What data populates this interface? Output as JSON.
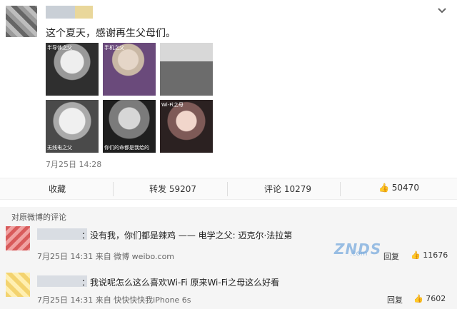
{
  "post": {
    "text": "这个夏天，感谢再生父母们。",
    "timestamp": "7月25日 14:28",
    "photos": [
      {
        "caption": "半导体之父",
        "bottom": ""
      },
      {
        "caption": "手机之父",
        "bottom": ""
      },
      {
        "caption": "",
        "bottom": ""
      },
      {
        "caption": "",
        "bottom": "无线电之父"
      },
      {
        "caption": "",
        "bottom": "你们的命都是我给的"
      },
      {
        "caption": "Wi-Fi之母",
        "bottom": ""
      }
    ]
  },
  "actions": {
    "favorite": "收藏",
    "repost": "转发 59207",
    "comment": "评论 10279",
    "like": "50470"
  },
  "comments": {
    "title": "对原微博的评论",
    "items": [
      {
        "text": "：没有我，你们都是辣鸡 —— 电学之父: 迈克尔·法拉第",
        "time": "7月25日 14:31 来自 微博 weibo.com",
        "reply": "回复",
        "likes": "11676"
      },
      {
        "text": "：我说呢怎么这么喜欢Wi-Fi 原来Wi-Fi之母这么好看",
        "time": "7月25日 14:31 来自 快快快快我iPhone 6s",
        "reply": "回复",
        "likes": "7602"
      }
    ]
  },
  "watermark": {
    "main": "ZNDS",
    "sub": ".com"
  }
}
